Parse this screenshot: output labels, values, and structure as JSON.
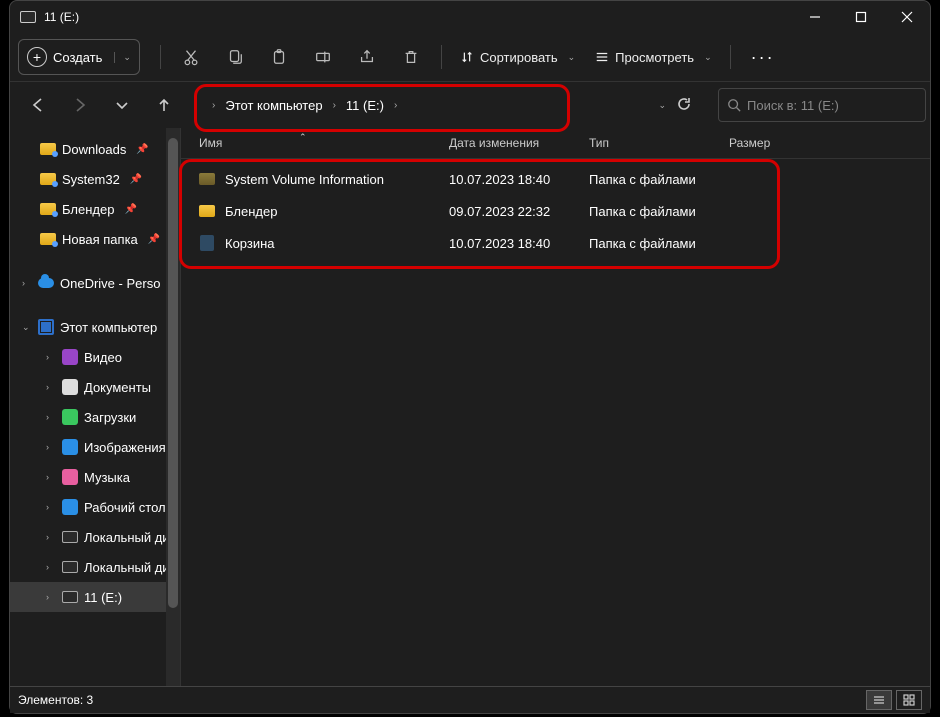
{
  "title": "11 (E:)",
  "toolbar": {
    "create": "Создать",
    "sort": "Сортировать",
    "view": "Просмотреть"
  },
  "breadcrumb": {
    "part1": "Этот компьютер",
    "part2": "11 (E:)"
  },
  "search": {
    "placeholder": "Поиск в: 11 (E:)"
  },
  "columns": {
    "name": "Имя",
    "date": "Дата изменения",
    "type": "Тип",
    "size": "Размер"
  },
  "files": [
    {
      "name": "System Volume Information",
      "date": "10.07.2023 18:40",
      "type": "Папка с файлами"
    },
    {
      "name": "Блендер",
      "date": "09.07.2023 22:32",
      "type": "Папка с файлами"
    },
    {
      "name": "Корзина",
      "date": "10.07.2023 18:40",
      "type": "Папка с файлами"
    }
  ],
  "sidebar": {
    "quick": [
      {
        "label": "Downloads",
        "pin": true
      },
      {
        "label": "System32",
        "pin": true
      },
      {
        "label": "Блендер",
        "pin": true
      },
      {
        "label": "Новая папка",
        "pin": true
      }
    ],
    "onedrive": "OneDrive - Perso",
    "thispc": "Этот компьютер",
    "pc_children": [
      {
        "label": "Видео",
        "color": "#9945c8"
      },
      {
        "label": "Документы",
        "color": "#ddd"
      },
      {
        "label": "Загрузки",
        "color": "#3ac85f"
      },
      {
        "label": "Изображения",
        "color": "#2a8fe6"
      },
      {
        "label": "Музыка",
        "color": "#e85fa0"
      },
      {
        "label": "Рабочий стол",
        "color": "#2a8fe6"
      },
      {
        "label": "Локальный ди",
        "drive": true
      },
      {
        "label": "Локальный ди",
        "drive": true
      },
      {
        "label": "11 (E:)",
        "drive": true,
        "sel": true
      }
    ]
  },
  "status": {
    "elements": "Элементов: 3"
  }
}
